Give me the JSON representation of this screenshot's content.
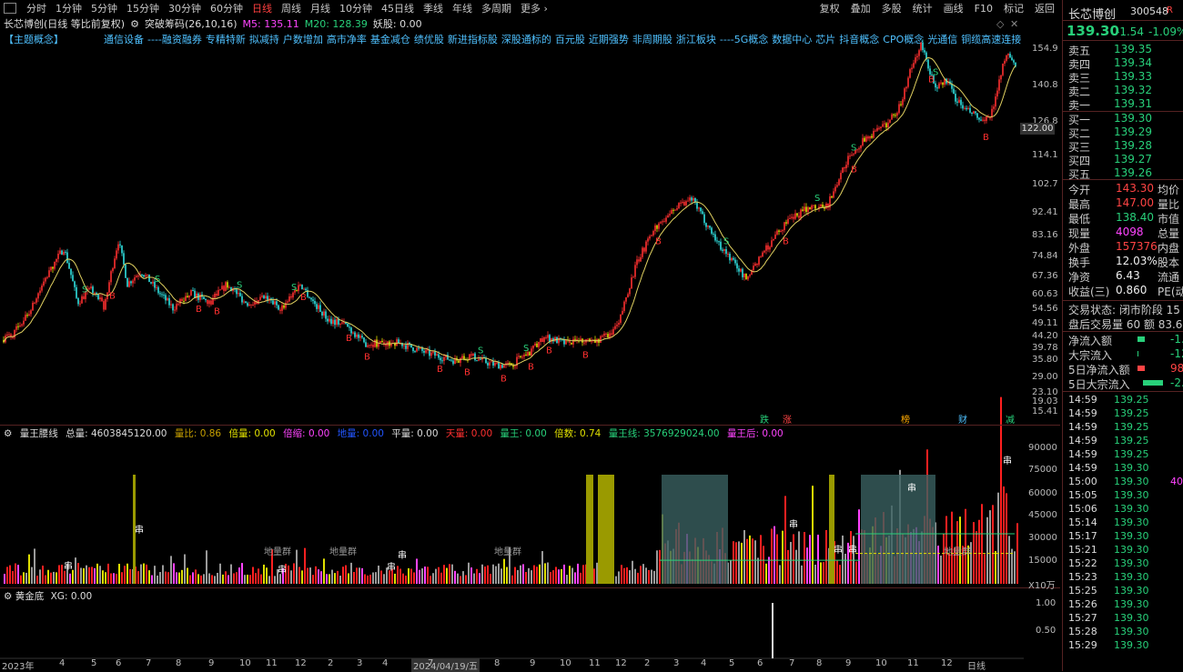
{
  "toolbar": {
    "periods": [
      "分时",
      "1分钟",
      "5分钟",
      "15分钟",
      "30分钟",
      "60分钟",
      "日线",
      "周线",
      "月线",
      "10分钟",
      "45日线",
      "季线",
      "年线",
      "多周期",
      "更多 ›"
    ],
    "active_period": "日线",
    "tools": [
      "复权",
      "叠加",
      "多股",
      "统计",
      "画线",
      "F10",
      "标记",
      "返回"
    ]
  },
  "header": {
    "stock_title": "长芯博创(日线 等比前复权)",
    "indicator": "突破筹码(26,10,16)",
    "m5": "M5: 135.11",
    "m20": "M20: 128.39",
    "yaogu": "妖股: 0.00"
  },
  "concepts": {
    "label": "【主题概念】",
    "items": [
      "通信设备",
      "----融资融券",
      "专精特新",
      "拟减持",
      "户数增加",
      "高市净率",
      "基金减仓",
      "绩优股",
      "新进指标股",
      "深股通标的",
      "百元股",
      "近期强势",
      "非周期股",
      "浙江板块",
      "----5G概念",
      "数据中心",
      "芯片",
      "抖音概念",
      "CPO概念",
      "光通信",
      "铜缆高速连接"
    ]
  },
  "price_axis": [
    "154.9",
    "140.8",
    "126.8",
    "114.1",
    "102.7",
    "92.41",
    "83.16",
    "74.84",
    "67.36",
    "60.63",
    "54.56",
    "49.11",
    "44.20",
    "39.78",
    "35.80",
    "29.00",
    "23.10",
    "19.03",
    "15.41"
  ],
  "price_tag": "122.00",
  "event_marks": [
    "跌",
    "涨",
    "榜",
    "财",
    "减"
  ],
  "volume_indicator": {
    "name": "量王腰线",
    "total": "总量: 4603845120.00",
    "ratio": "量比: 0.86",
    "bei": "倍量: 0.00",
    "beisuo": "倍缩: 0.00",
    "dl": "地量: 0.00",
    "ping": "平量: 0.00",
    "tian": "天量: 0.00",
    "wang": "量王: 0.00",
    "beishu": "倍数: 0.74",
    "wangxian": "量王线: 3576929024.00",
    "wanghou": "量王后: 0.00"
  },
  "volume_axis": [
    "90000",
    "75000",
    "60000",
    "45000",
    "30000",
    "15000",
    "X10万"
  ],
  "volume_labels": [
    "地量群",
    "地量群",
    "地量群",
    "地量群"
  ],
  "chuan": "串",
  "gold_indicator": {
    "name": "黄金底",
    "xg": "XG: 0.00"
  },
  "gold_axis": [
    "1.00",
    "0.50"
  ],
  "x_axis": [
    "2023年",
    "4",
    "5",
    "6",
    "7",
    "8",
    "9",
    "10",
    "11",
    "12",
    "2",
    "3",
    "4",
    "2024/04/19/五",
    "7",
    "8",
    "9",
    "10",
    "11",
    "12",
    "2",
    "3",
    "4",
    "5",
    "6",
    "7",
    "8",
    "9",
    "10",
    "11",
    "12",
    "日线"
  ],
  "right_panel": {
    "name": "长芯博创",
    "code": "300548",
    "flag": "R",
    "price": "139.30",
    "change": "-1.54",
    "pct": "-1.09%",
    "asks": [
      {
        "label": "卖五",
        "price": "139.35"
      },
      {
        "label": "卖四",
        "price": "139.34"
      },
      {
        "label": "卖三",
        "price": "139.33"
      },
      {
        "label": "卖二",
        "price": "139.32"
      },
      {
        "label": "卖一",
        "price": "139.31"
      }
    ],
    "bids": [
      {
        "label": "买一",
        "price": "139.30"
      },
      {
        "label": "买二",
        "price": "139.29"
      },
      {
        "label": "买三",
        "price": "139.28"
      },
      {
        "label": "买四",
        "price": "139.27"
      },
      {
        "label": "买五",
        "price": "139.26"
      }
    ],
    "stats": [
      {
        "k": "今开",
        "v": "143.30",
        "c": "red",
        "k2": "均价"
      },
      {
        "k": "最高",
        "v": "147.00",
        "c": "red",
        "k2": "量比"
      },
      {
        "k": "最低",
        "v": "138.40",
        "c": "grn",
        "k2": "市值"
      },
      {
        "k": "现量",
        "v": "4098",
        "c": "mag",
        "k2": "总量"
      },
      {
        "k": "外盘",
        "v": "157376",
        "c": "red",
        "k2": "内盘"
      },
      {
        "k": "换手",
        "v": "12.03%",
        "c": "wht",
        "k2": "股本"
      },
      {
        "k": "净资",
        "v": "6.43",
        "c": "wht",
        "k2": "流通"
      },
      {
        "k": "收益(三)",
        "v": "0.860",
        "c": "wht",
        "k2": "PE(动"
      }
    ],
    "status": "交易状态: 闭市阶段 15",
    "after_vol": "盘后交易量 60 额 83.6",
    "flows": [
      {
        "k": "净流入额",
        "v": "-1."
      },
      {
        "k": "大宗流入",
        "v": "-12"
      },
      {
        "k": "5日净流入额",
        "v": "98"
      },
      {
        "k": "5日大宗流入",
        "v": "-2."
      }
    ],
    "ticks": [
      {
        "t": "14:59",
        "p": "139.25",
        "v": ""
      },
      {
        "t": "14:59",
        "p": "139.25",
        "v": ""
      },
      {
        "t": "14:59",
        "p": "139.25",
        "v": ""
      },
      {
        "t": "14:59",
        "p": "139.25",
        "v": ""
      },
      {
        "t": "14:59",
        "p": "139.25",
        "v": ""
      },
      {
        "t": "14:59",
        "p": "139.30",
        "v": ""
      },
      {
        "t": "15:00",
        "p": "139.30",
        "v": "40"
      },
      {
        "t": "15:05",
        "p": "139.30",
        "v": ""
      },
      {
        "t": "15:06",
        "p": "139.30",
        "v": ""
      },
      {
        "t": "15:14",
        "p": "139.30",
        "v": ""
      },
      {
        "t": "15:17",
        "p": "139.30",
        "v": ""
      },
      {
        "t": "15:21",
        "p": "139.30",
        "v": ""
      },
      {
        "t": "15:22",
        "p": "139.30",
        "v": ""
      },
      {
        "t": "15:23",
        "p": "139.30",
        "v": ""
      },
      {
        "t": "15:25",
        "p": "139.30",
        "v": ""
      },
      {
        "t": "15:26",
        "p": "139.30",
        "v": ""
      },
      {
        "t": "15:27",
        "p": "139.30",
        "v": ""
      },
      {
        "t": "15:28",
        "p": "139.30",
        "v": ""
      },
      {
        "t": "15:29",
        "p": "139.30",
        "v": ""
      }
    ]
  },
  "colors": {
    "up": "#ff3030",
    "down": "#30e0e0",
    "accent": "#28d07a",
    "ma": "#e0d060"
  }
}
